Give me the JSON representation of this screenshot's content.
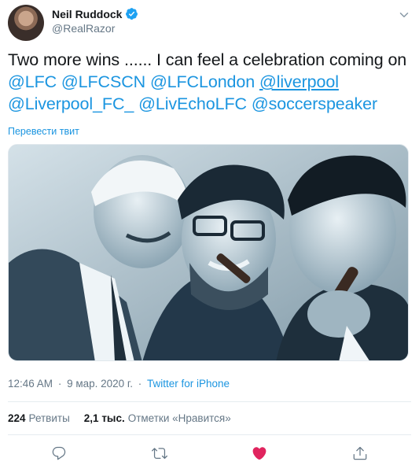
{
  "author": {
    "display_name": "Neil Ruddock",
    "handle": "@RealRazor",
    "verified": true
  },
  "tweet": {
    "text_lines": [
      [
        {
          "t": "Two more wins ...... I can feel a celebration coming on",
          "k": "text"
        }
      ],
      [
        {
          "t": "@LFC",
          "k": "mention"
        },
        {
          "t": " ",
          "k": "text"
        },
        {
          "t": "@LFCSCN",
          "k": "mention"
        },
        {
          "t": " ",
          "k": "text"
        },
        {
          "t": "@LFCLondon",
          "k": "mention"
        },
        {
          "t": " ",
          "k": "text"
        },
        {
          "t": "@liverpool",
          "k": "mention-underline"
        }
      ],
      [
        {
          "t": "@Liverpool_FC_",
          "k": "mention"
        },
        {
          "t": " ",
          "k": "text"
        },
        {
          "t": "@LivEchoLFC",
          "k": "mention"
        },
        {
          "t": " ",
          "k": "text"
        },
        {
          "t": "@soccerspeaker",
          "k": "mention"
        }
      ]
    ],
    "translate_label": "Перевести твит",
    "photo_alt": "Three men laughing and smoking cigars",
    "time": "12:46 AM",
    "date": "9 мар. 2020 г.",
    "separator": "·",
    "source": "Twitter for iPhone"
  },
  "stats": {
    "retweets_count": "224",
    "retweets_label": "Ретвиты",
    "likes_count": "2,1 тыс.",
    "likes_label": "Отметки «Нравится»"
  },
  "colors": {
    "accent": "#1b95e0",
    "like": "#e0245e",
    "secondary_text": "#657786",
    "icon": "#657786"
  },
  "actions": [
    {
      "name": "reply",
      "icon": "speech-bubble-icon"
    },
    {
      "name": "retweet",
      "icon": "retweet-icon"
    },
    {
      "name": "like",
      "icon": "heart-icon",
      "active": true
    },
    {
      "name": "share",
      "icon": "share-icon"
    }
  ]
}
